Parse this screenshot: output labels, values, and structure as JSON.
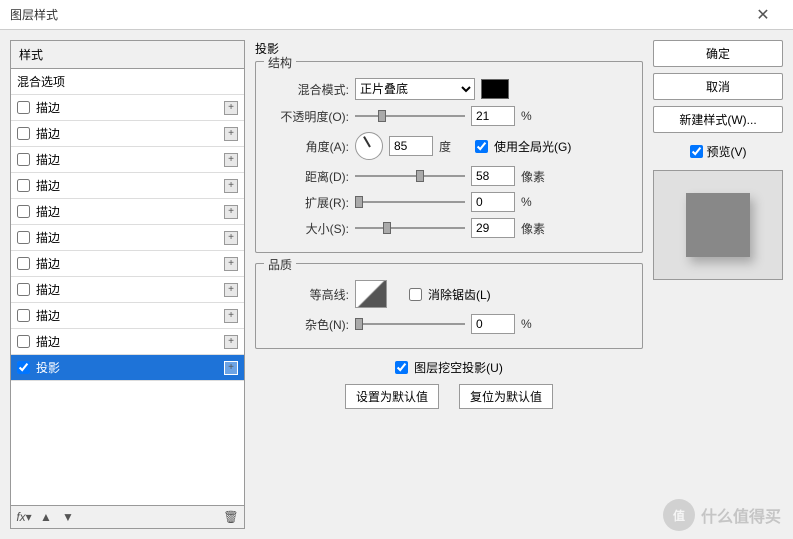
{
  "window": {
    "title": "图层样式",
    "close": "✕"
  },
  "sidebar": {
    "header": "样式",
    "blend_options": "混合选项",
    "items": [
      "描边",
      "描边",
      "描边",
      "描边",
      "描边",
      "描边",
      "描边",
      "描边",
      "描边",
      "描边",
      "投影"
    ],
    "checked_index": 10,
    "selected_index": 10,
    "footer": {
      "fx": "fx",
      "up": "▲",
      "down": "▼",
      "trash": "🗑"
    }
  },
  "panel": {
    "title": "投影",
    "structure": {
      "legend": "结构",
      "blend_mode_label": "混合模式:",
      "blend_mode_value": "正片叠底",
      "opacity_label": "不透明度(O):",
      "opacity_value": "21",
      "opacity_unit": "%",
      "opacity_pos": "21%",
      "angle_label": "角度(A):",
      "angle_value": "85",
      "angle_unit": "度",
      "global_light_label": "使用全局光(G)",
      "global_light_checked": true,
      "distance_label": "距离(D):",
      "distance_value": "58",
      "distance_unit": "像素",
      "distance_pos": "55%",
      "spread_label": "扩展(R):",
      "spread_value": "0",
      "spread_unit": "%",
      "spread_pos": "0%",
      "size_label": "大小(S):",
      "size_value": "29",
      "size_unit": "像素",
      "size_pos": "25%"
    },
    "quality": {
      "legend": "品质",
      "contour_label": "等高线:",
      "antialias_label": "消除锯齿(L)",
      "antialias_checked": false,
      "noise_label": "杂色(N):",
      "noise_value": "0",
      "noise_unit": "%",
      "noise_pos": "0%"
    },
    "knockout_label": "图层挖空投影(U)",
    "knockout_checked": true,
    "make_default": "设置为默认值",
    "reset_default": "复位为默认值"
  },
  "right": {
    "ok": "确定",
    "cancel": "取消",
    "new_style": "新建样式(W)...",
    "preview_label": "预览(V)",
    "preview_checked": true
  },
  "watermark": {
    "badge": "值",
    "text": "什么值得买"
  }
}
